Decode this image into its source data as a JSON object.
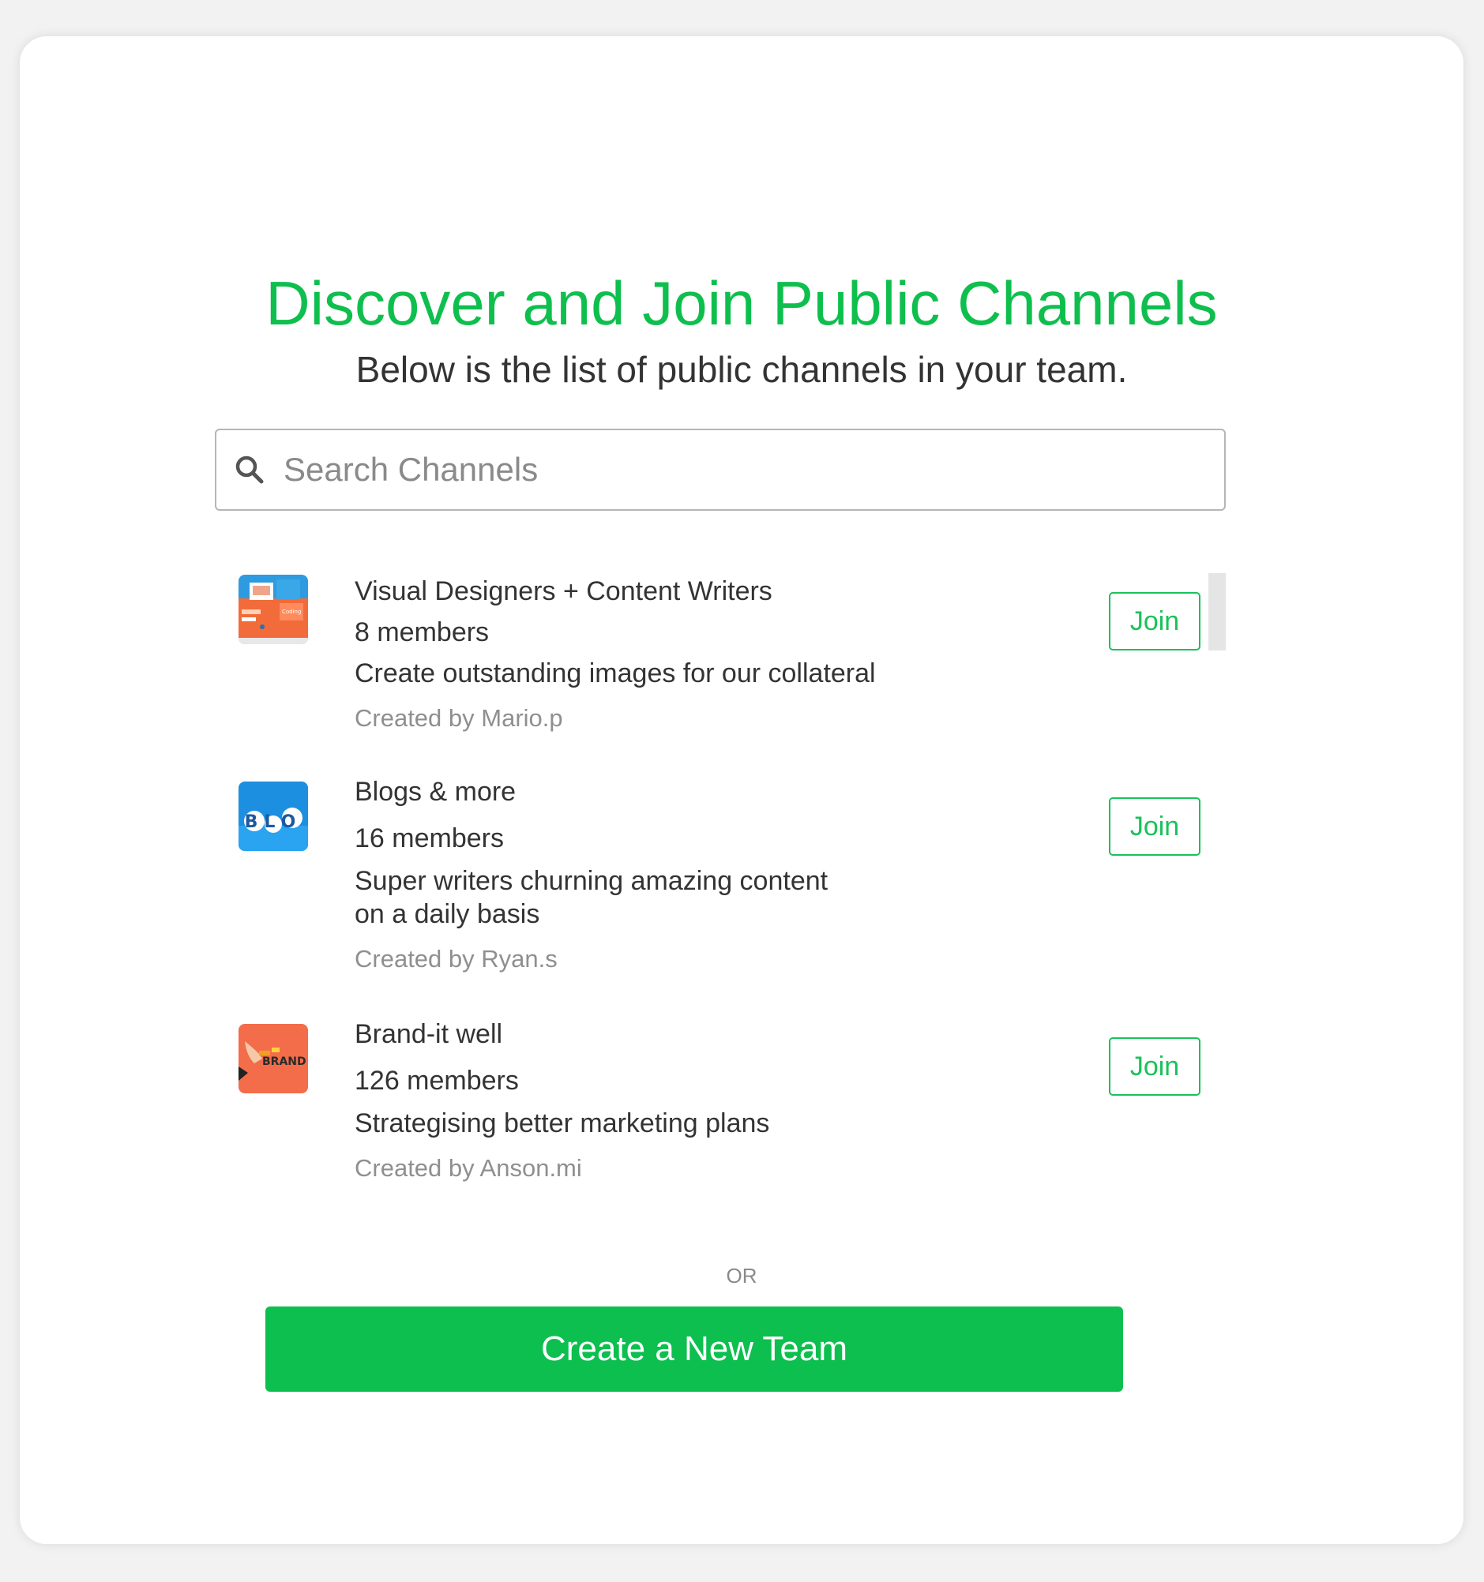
{
  "header": {
    "title": "Discover and Join Public Channels",
    "subtitle": "Below is the list of public channels in your team."
  },
  "search": {
    "placeholder": "Search Channels",
    "value": ""
  },
  "channels": [
    {
      "name": "Visual Designers + Content Writers",
      "members": "8 members",
      "description_lines": [
        "Create outstanding images for our collateral"
      ],
      "created_by": "Created by Mario.p",
      "join_label": "Join",
      "avatar_icon": "coding-illustration-icon",
      "avatar_text": "Coding"
    },
    {
      "name": "Blogs & more",
      "members": "16 members",
      "description_lines": [
        "Super writers churning amazing content",
        "on a daily basis"
      ],
      "created_by": "Created by Ryan.s",
      "join_label": "Join",
      "avatar_icon": "blog-bubbles-icon",
      "avatar_text": "BLO"
    },
    {
      "name": "Brand-it well",
      "members": "126 members",
      "description_lines": [
        "Strategising better marketing plans"
      ],
      "created_by": "Created by Anson.mi",
      "join_label": "Join",
      "avatar_icon": "brand-hand-icon",
      "avatar_text": "BRAND"
    }
  ],
  "divider": {
    "or_label": "OR"
  },
  "create_team": {
    "label": "Create a New Team"
  },
  "colors": {
    "accent": "#0fbf4e",
    "join_border": "#19c25a",
    "create_button": "#0cbf4f"
  }
}
